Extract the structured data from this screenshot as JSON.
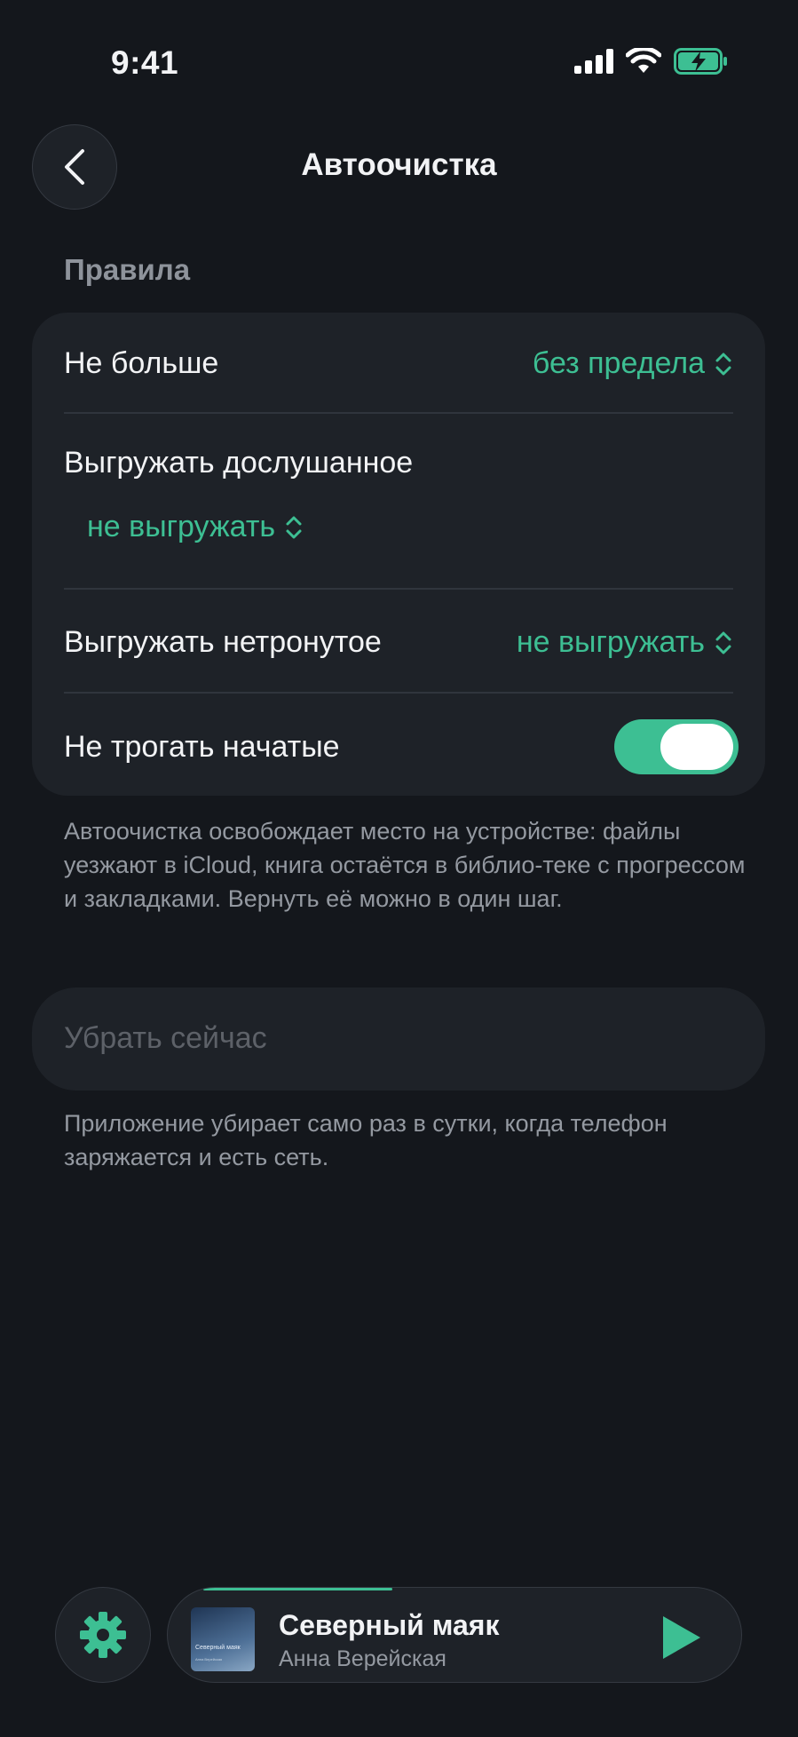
{
  "status": {
    "time": "9:41"
  },
  "nav": {
    "title": "Автоочистка"
  },
  "section": {
    "title": "Правила"
  },
  "rules": [
    {
      "label": "Не больше",
      "value": "без предела"
    },
    {
      "label": "Выгружать дослушанное",
      "value": "не выгружать"
    },
    {
      "label": "Выгружать нетронутое",
      "value": "не выгружать"
    },
    {
      "label": "Не трогать начатые",
      "toggle_on": true
    }
  ],
  "rules_note": "Автоочистка освобождает место на устройстве: файлы уезжают в iCloud, книга остаётся в библио-теке с прогрессом и закладками. Вернуть её можно в один шаг.",
  "clear_button": {
    "label": "Убрать сейчас",
    "disabled": true
  },
  "clear_note": "Приложение убирает само раз в сутки, когда телефон заряжается и есть сеть.",
  "player": {
    "title": "Северный маяк",
    "author": "Анна Верейская",
    "cover_title": "Северный маяк",
    "cover_author": "Анна Верейская",
    "progress": 0.38
  },
  "colors": {
    "accent": "#3dbf93",
    "background": "#14171c",
    "card": "#1e2228"
  }
}
